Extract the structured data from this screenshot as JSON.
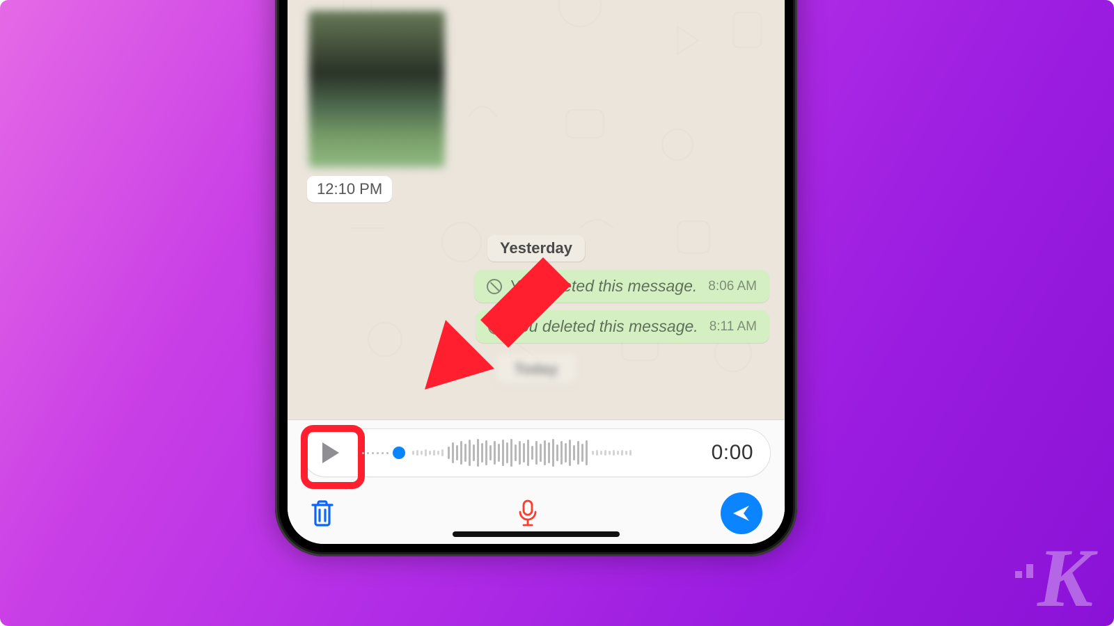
{
  "chat": {
    "image_timestamp": "12:10 PM",
    "date_divider": "Yesterday",
    "deleted_messages": [
      {
        "text": "You deleted this message.",
        "time": "8:06 AM"
      },
      {
        "text": "You deleted this message.",
        "time": "8:11 AM"
      }
    ],
    "blurred_pill": "Today"
  },
  "recorder": {
    "play_label": "Play",
    "time": "0:00"
  },
  "toolbar": {
    "trash_label": "Delete",
    "mic_label": "Record",
    "send_label": "Send"
  },
  "watermark": "K"
}
